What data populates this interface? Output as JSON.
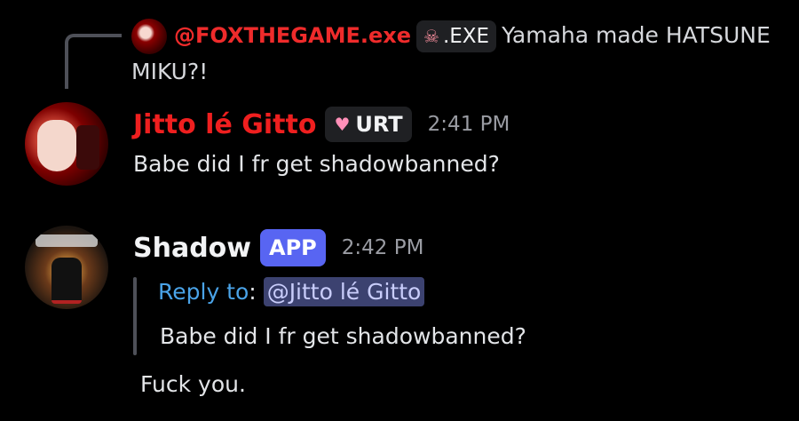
{
  "colors": {
    "background": "#000000",
    "author_red": "#ef1f1f",
    "app_badge": "#5865f2",
    "reply_blue": "#4aa3e8",
    "mention_bg": "#3c4270",
    "timestamp": "#9a9ca3"
  },
  "reply_reference": {
    "author": "@FOXTHEGAME.exe",
    "tag_icon": "skull-icon",
    "tag": ".EXE",
    "text": "Yamaha made HATSUNE MIKU?!"
  },
  "messages": [
    {
      "author": "Jitto lé Gitto",
      "role_icon": "heart-icon",
      "role_tag": "URT",
      "time": "2:41 PM",
      "text": "Babe did I fr get shadowbanned?"
    },
    {
      "author": "Shadow",
      "badge": "APP",
      "time": "2:42 PM",
      "quote": {
        "label": "Reply to",
        "colon": ":",
        "mention": "@Jitto lé Gitto",
        "text": "Babe did I fr get shadowbanned?"
      },
      "text": "Fuck you."
    }
  ]
}
